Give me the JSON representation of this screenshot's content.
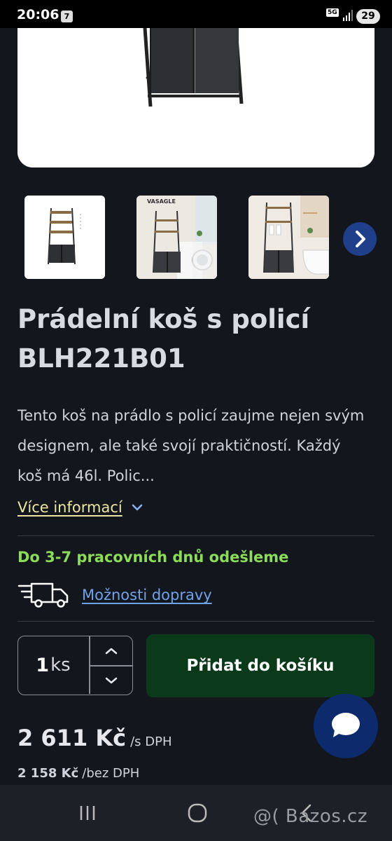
{
  "status_bar": {
    "time": "20:06",
    "notification_count": "7",
    "network": "5G",
    "battery": "29"
  },
  "product": {
    "title": "Prádelní koš s policí BLH221B01",
    "description": "Tento koš na prádlo s policí zaujme nejen svým designem, ale také svojí praktičností. Každý koš má 46l. Polic...",
    "more_info_label": "Více informací",
    "thumb_brand": "VASAGLE"
  },
  "shipping": {
    "dispatch_text": "Do 3-7 pracovních dnů odešleme",
    "delivery_options_label": "Možnosti dopravy"
  },
  "quantity": {
    "value": "1",
    "unit": "ks"
  },
  "cart": {
    "add_label": "Přidat do košíku"
  },
  "price": {
    "with_vat": "2 611 Kč",
    "with_vat_suffix": "/s DPH",
    "without_vat": "2 158 Kč",
    "without_vat_suffix": "/bez DPH"
  },
  "watermark": "@( Bazos.cz",
  "colors": {
    "background": "#14161e",
    "accent_green": "#8bdc58",
    "link_blue": "#6fa3e8",
    "cart_button": "#0a3a1a",
    "chat_button": "#0d2a6d"
  }
}
